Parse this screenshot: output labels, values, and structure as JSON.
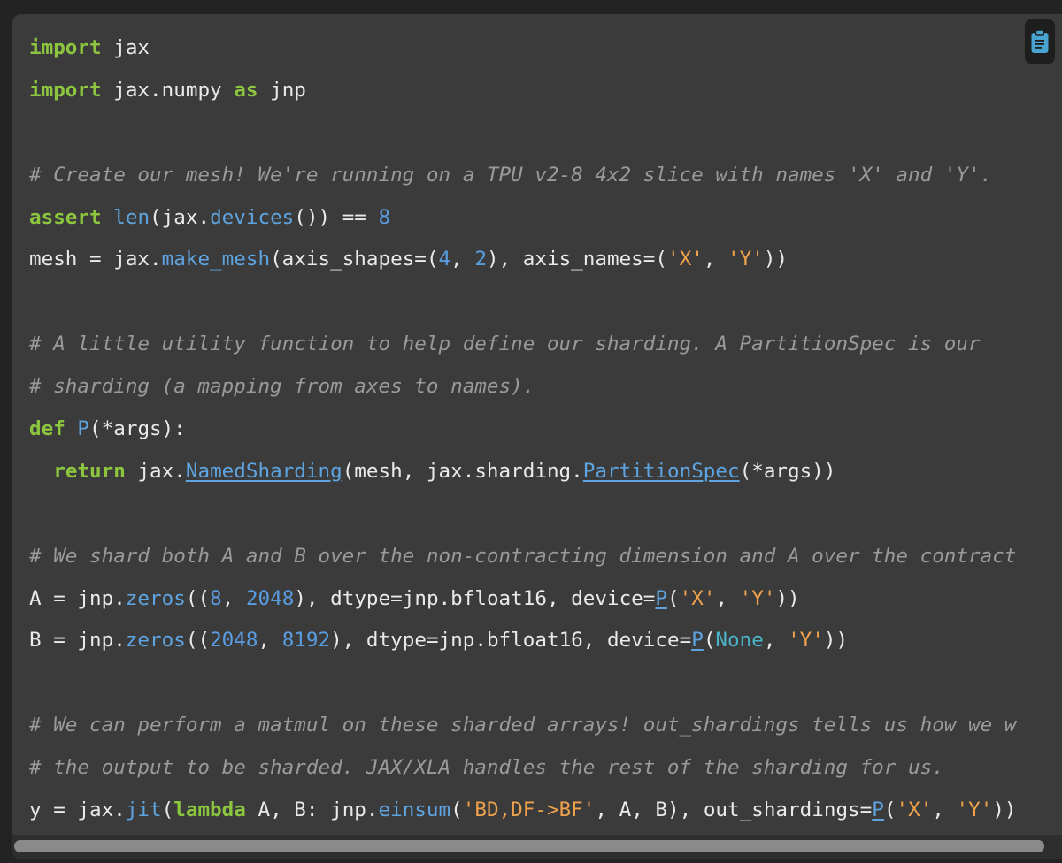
{
  "code": {
    "lines": [
      [
        {
          "t": "kw",
          "v": "import"
        },
        {
          "t": "",
          "v": " jax"
        }
      ],
      [
        {
          "t": "kw",
          "v": "import"
        },
        {
          "t": "",
          "v": " jax.numpy "
        },
        {
          "t": "kw",
          "v": "as"
        },
        {
          "t": "",
          "v": " jnp"
        }
      ],
      [],
      [
        {
          "t": "cm",
          "v": "# Create our mesh! We're running on a TPU v2-8 4x2 slice with names 'X' and 'Y'."
        }
      ],
      [
        {
          "t": "kw",
          "v": "assert"
        },
        {
          "t": "",
          "v": " "
        },
        {
          "t": "fn",
          "v": "len"
        },
        {
          "t": "",
          "v": "(jax."
        },
        {
          "t": "fn",
          "v": "devices"
        },
        {
          "t": "",
          "v": "()) == "
        },
        {
          "t": "num",
          "v": "8"
        }
      ],
      [
        {
          "t": "",
          "v": "mesh = jax."
        },
        {
          "t": "fn",
          "v": "make_mesh"
        },
        {
          "t": "",
          "v": "(axis_shapes=("
        },
        {
          "t": "num",
          "v": "4"
        },
        {
          "t": "",
          "v": ", "
        },
        {
          "t": "num",
          "v": "2"
        },
        {
          "t": "",
          "v": "), axis_names=("
        },
        {
          "t": "str",
          "v": "'X'"
        },
        {
          "t": "",
          "v": ", "
        },
        {
          "t": "str",
          "v": "'Y'"
        },
        {
          "t": "",
          "v": "))"
        }
      ],
      [],
      [
        {
          "t": "cm",
          "v": "# A little utility function to help define our sharding. A PartitionSpec is our"
        }
      ],
      [
        {
          "t": "cm",
          "v": "# sharding (a mapping from axes to names)."
        }
      ],
      [
        {
          "t": "kw",
          "v": "def"
        },
        {
          "t": "",
          "v": " "
        },
        {
          "t": "fn",
          "v": "P"
        },
        {
          "t": "",
          "v": "(*args):"
        }
      ],
      [
        {
          "t": "",
          "v": "  "
        },
        {
          "t": "kw",
          "v": "return"
        },
        {
          "t": "",
          "v": " jax."
        },
        {
          "t": "fn ul",
          "v": "NamedSharding"
        },
        {
          "t": "",
          "v": "(mesh, jax.sharding."
        },
        {
          "t": "fn ul",
          "v": "PartitionSpec"
        },
        {
          "t": "",
          "v": "(*args))"
        }
      ],
      [],
      [
        {
          "t": "cm",
          "v": "# We shard both A and B over the non-contracting dimension and A over the contract"
        }
      ],
      [
        {
          "t": "",
          "v": "A = jnp."
        },
        {
          "t": "fn",
          "v": "zeros"
        },
        {
          "t": "",
          "v": "(("
        },
        {
          "t": "num",
          "v": "8"
        },
        {
          "t": "",
          "v": ", "
        },
        {
          "t": "num",
          "v": "2048"
        },
        {
          "t": "",
          "v": "), dtype=jnp.bfloat16, device="
        },
        {
          "t": "fn ul",
          "v": "P"
        },
        {
          "t": "",
          "v": "("
        },
        {
          "t": "str",
          "v": "'X'"
        },
        {
          "t": "",
          "v": ", "
        },
        {
          "t": "str",
          "v": "'Y'"
        },
        {
          "t": "",
          "v": "))"
        }
      ],
      [
        {
          "t": "",
          "v": "B = jnp."
        },
        {
          "t": "fn",
          "v": "zeros"
        },
        {
          "t": "",
          "v": "(("
        },
        {
          "t": "num",
          "v": "2048"
        },
        {
          "t": "",
          "v": ", "
        },
        {
          "t": "num",
          "v": "8192"
        },
        {
          "t": "",
          "v": "), dtype=jnp.bfloat16, device="
        },
        {
          "t": "fn ul",
          "v": "P"
        },
        {
          "t": "",
          "v": "("
        },
        {
          "t": "const",
          "v": "None"
        },
        {
          "t": "",
          "v": ", "
        },
        {
          "t": "str",
          "v": "'Y'"
        },
        {
          "t": "",
          "v": "))"
        }
      ],
      [],
      [
        {
          "t": "cm",
          "v": "# We can perform a matmul on these sharded arrays! out_shardings tells us how we w"
        }
      ],
      [
        {
          "t": "cm",
          "v": "# the output to be sharded. JAX/XLA handles the rest of the sharding for us."
        }
      ],
      [
        {
          "t": "",
          "v": "y = jax."
        },
        {
          "t": "fn",
          "v": "jit"
        },
        {
          "t": "",
          "v": "("
        },
        {
          "t": "kw",
          "v": "lambda"
        },
        {
          "t": "",
          "v": " A, B: jnp."
        },
        {
          "t": "fn",
          "v": "einsum"
        },
        {
          "t": "",
          "v": "("
        },
        {
          "t": "str",
          "v": "'BD,DF->BF'"
        },
        {
          "t": "",
          "v": ", A, B), out_shardings="
        },
        {
          "t": "fn ul",
          "v": "P"
        },
        {
          "t": "",
          "v": "("
        },
        {
          "t": "str",
          "v": "'X'"
        },
        {
          "t": "",
          "v": ", "
        },
        {
          "t": "str",
          "v": "'Y'"
        },
        {
          "t": "",
          "v": "))"
        }
      ]
    ]
  },
  "copy_button": {
    "icon": "clipboard-icon"
  },
  "colors": {
    "panel_bg": "#3b3b3b",
    "keyword": "#8cc63f",
    "function": "#5ea4e0",
    "number": "#5a9ce0",
    "string": "#f0a24c",
    "constant": "#4bb3c7",
    "comment": "#9a9a9a",
    "icon": "#49a3d1"
  },
  "scrollbar": {
    "thumb_fraction": 0.98
  }
}
